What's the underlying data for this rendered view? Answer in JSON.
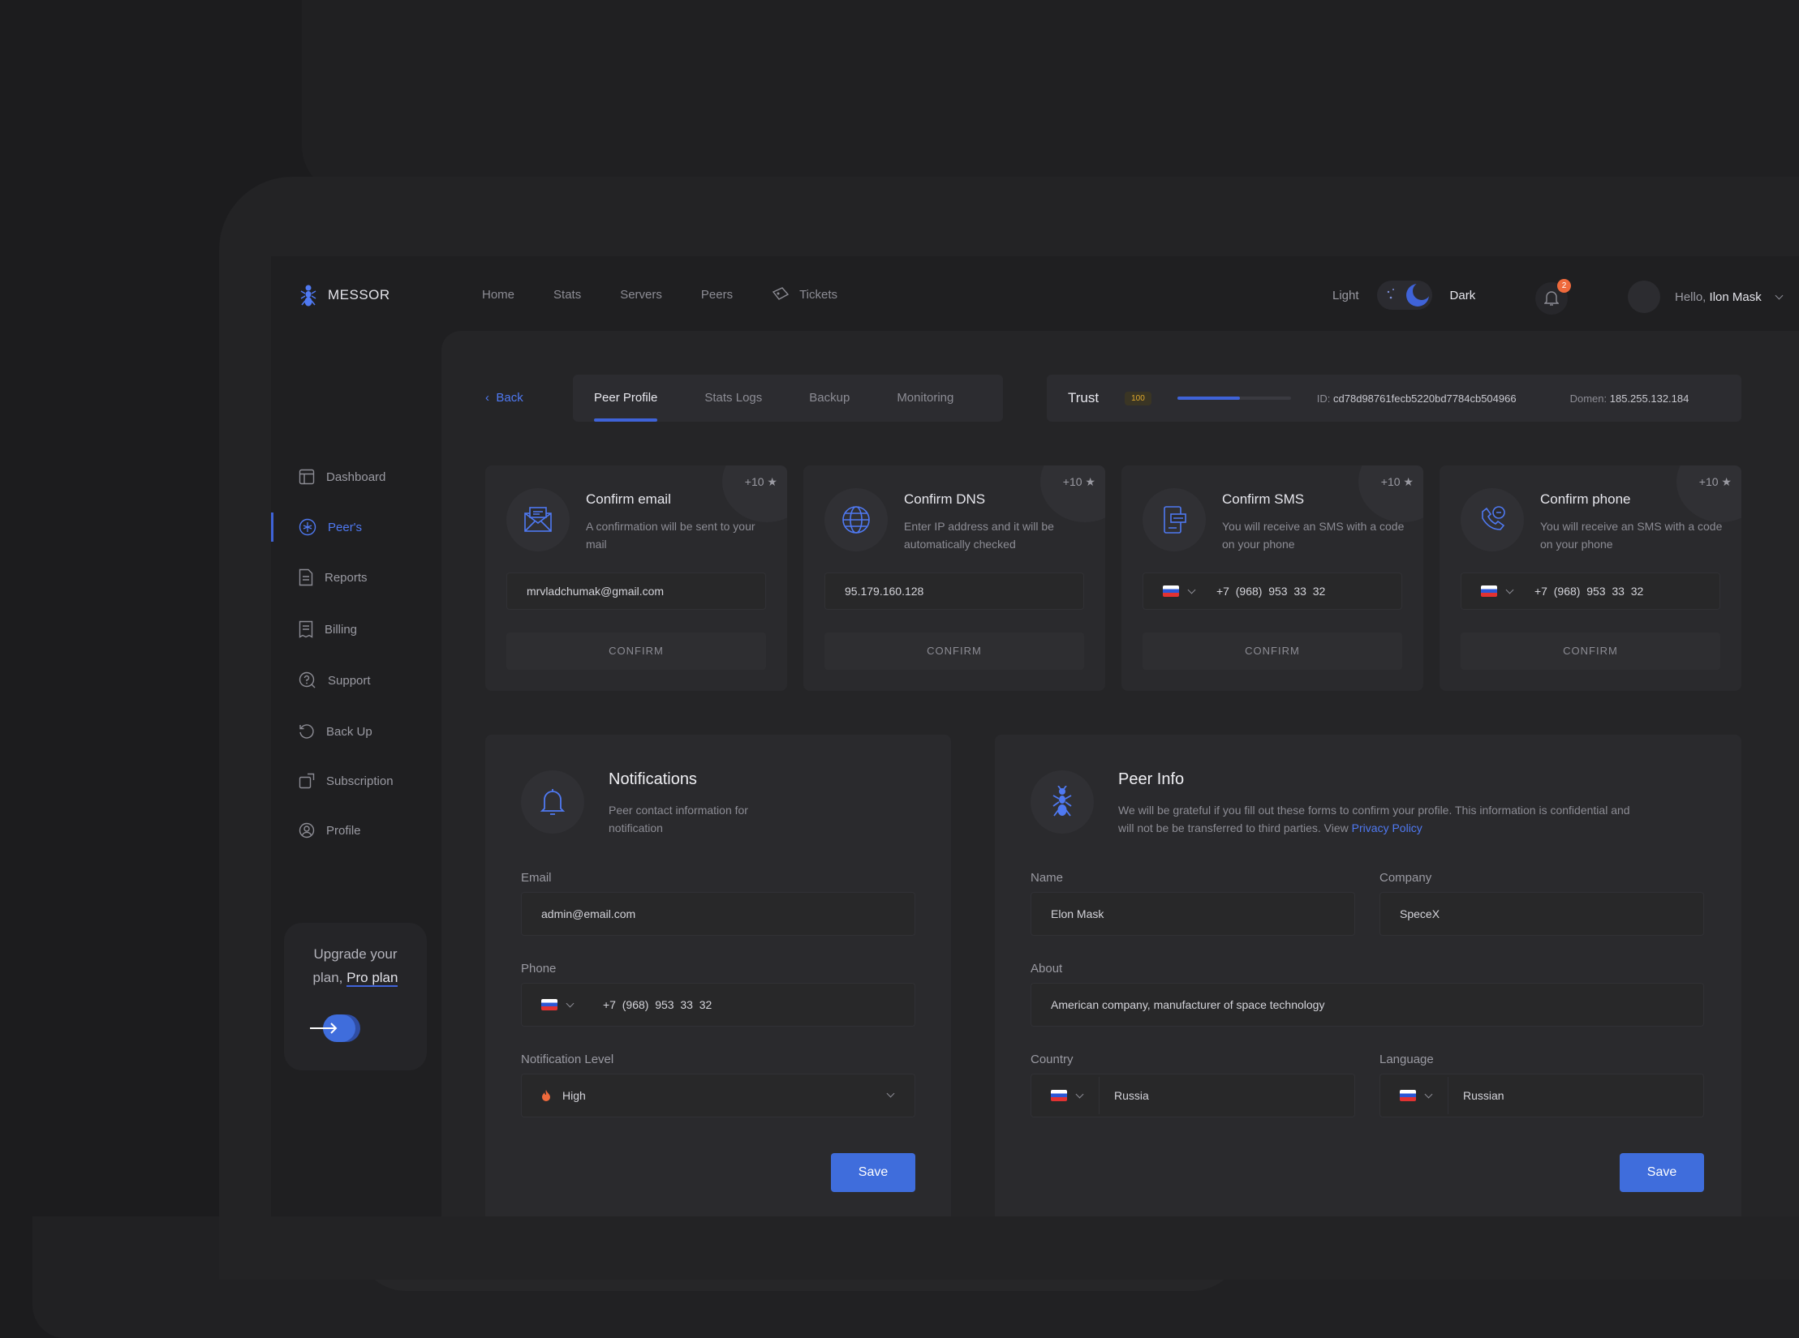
{
  "app": {
    "name": "MESSOR"
  },
  "topnav": {
    "home": "Home",
    "stats": "Stats",
    "servers": "Servers",
    "peers": "Peers",
    "tickets": "Tickets"
  },
  "theme": {
    "light": "Light",
    "dark": "Dark"
  },
  "notifications_count": "2",
  "user": {
    "greeting": "Hello,",
    "name": "Ilon Mask"
  },
  "sidebar": {
    "items": [
      {
        "label": "Dashboard",
        "icon": "dashboard-icon"
      },
      {
        "label": "Peer's",
        "icon": "peers-icon",
        "active": true
      },
      {
        "label": "Reports",
        "icon": "reports-icon"
      },
      {
        "label": "Billing",
        "icon": "billing-icon"
      },
      {
        "label": "Support",
        "icon": "support-icon"
      },
      {
        "label": "Back Up",
        "icon": "backup-icon"
      },
      {
        "label": "Subscription",
        "icon": "subscription-icon"
      },
      {
        "label": "Profile",
        "icon": "profile-icon"
      }
    ]
  },
  "upgrade": {
    "line1": "Upgrade your",
    "line2": "plan,",
    "plan": "Pro plan"
  },
  "back": "Back",
  "tabs": [
    "Peer Profile",
    "Stats Logs",
    "Backup",
    "Monitoring"
  ],
  "trust": {
    "title": "Trust",
    "value": "100",
    "progress": 0.55,
    "id_label": "ID:",
    "id": "cd78d98761fecb5220bd7784cb504966",
    "domain_label": "Domen:",
    "domain": "185.255.132.184"
  },
  "cards": [
    {
      "title": "Confirm email",
      "desc": "A confirmation will be sent to your mail",
      "value": "mrvladchumak@gmail.com",
      "bonus": "+10 ★",
      "button": "CONFIRM",
      "icon": "envelope-icon"
    },
    {
      "title": "Confirm DNS",
      "desc": "Enter IP address and it will be automatically checked",
      "value": "95.179.160.128",
      "bonus": "+10 ★",
      "button": "CONFIRM",
      "icon": "globe-icon"
    },
    {
      "title": "Confirm SMS",
      "desc": "You will receive an SMS with a code on your phone",
      "value": "+7  (968)  953  33  32",
      "bonus": "+10 ★",
      "button": "CONFIRM",
      "icon": "sms-icon"
    },
    {
      "title": "Confirm phone",
      "desc": "You will receive an SMS with a code on your phone",
      "value": "+7  (968)  953  33  32",
      "bonus": "+10 ★",
      "button": "CONFIRM",
      "icon": "phone-icon"
    }
  ],
  "notifications": {
    "title": "Notifications",
    "desc1": "Peer contact information for",
    "desc2": "notification",
    "email_label": "Email",
    "email": "admin@email.com",
    "phone_label": "Phone",
    "phone": "+7  (968)  953  33  32",
    "level_label": "Notification Level",
    "level": "High",
    "save": "Save"
  },
  "peer_info": {
    "title": "Peer Info",
    "desc1": "We will be grateful if you fill out these forms to confirm your profile. This information is confidential and",
    "desc2": "will not be  be transferred to third parties. View",
    "link": "Privacy Policy",
    "name_label": "Name",
    "name": "Elon Mask",
    "company_label": "Company",
    "company": "SpeceX",
    "about_label": "About",
    "about": "American company, manufacturer of space technology",
    "country_label": "Country",
    "country": "Russia",
    "language_label": "Language",
    "language": "Russian",
    "save": "Save"
  },
  "colors": {
    "accent": "#3f63d8",
    "accent_text": "#4f79f2",
    "background": "#1c1c1e",
    "card": "#2a2a2d",
    "trust_badge": "#e0a92c",
    "notification_badge": "#ef6a3c"
  }
}
